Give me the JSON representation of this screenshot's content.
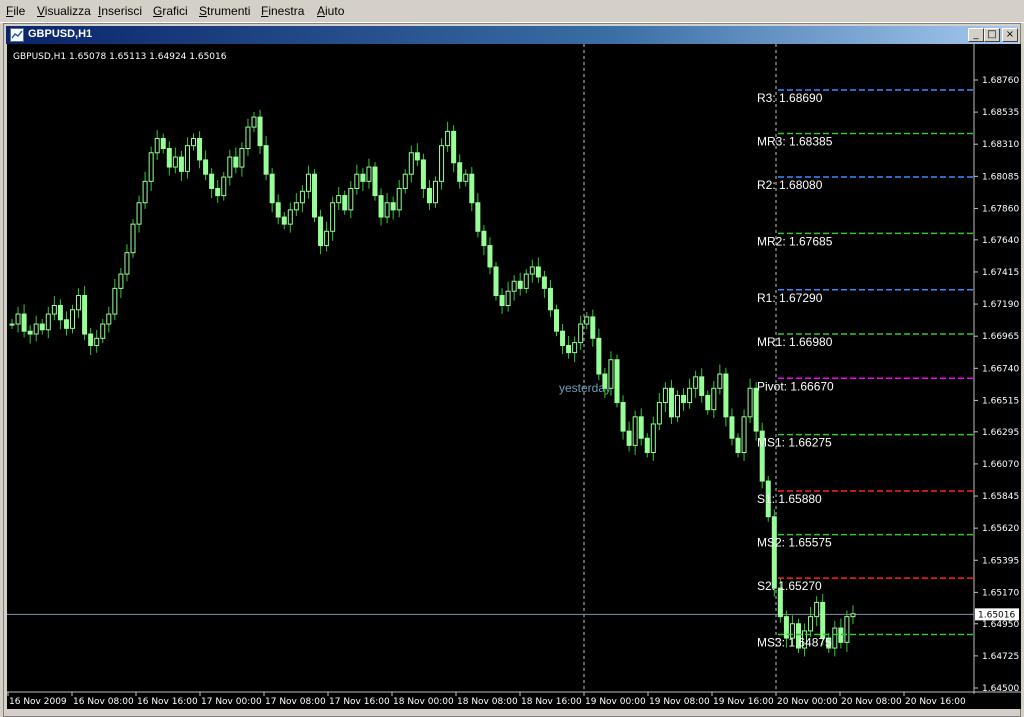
{
  "menu": [
    "File",
    "Visualizza",
    "Inserisci",
    "Grafici",
    "Strumenti",
    "Finestra",
    "Aiuto"
  ],
  "window": {
    "title": "GBPUSD,H1",
    "buttons": [
      "_",
      "□",
      "×"
    ]
  },
  "chart": {
    "info_line": "GBPUSD,H1  1.65078 1.65113 1.64924 1.65016",
    "price_ticks": [
      "1.68760",
      "1.68535",
      "1.68310",
      "1.68085",
      "1.67860",
      "1.67640",
      "1.67415",
      "1.67190",
      "1.66965",
      "1.66740",
      "1.66515",
      "1.66295",
      "1.66070",
      "1.65845",
      "1.65620",
      "1.65395",
      "1.65170",
      "1.64950",
      "1.64725",
      "1.64500"
    ],
    "price_range": [
      1.645,
      1.6885
    ],
    "current_price": "1.65016",
    "time_ticks": [
      "16 Nov 2009",
      "16 Nov 08:00",
      "16 Nov 16:00",
      "17 Nov 00:00",
      "17 Nov 08:00",
      "17 Nov 16:00",
      "18 Nov 00:00",
      "18 Nov 08:00",
      "18 Nov 16:00",
      "19 Nov 00:00",
      "19 Nov 08:00",
      "19 Nov 16:00",
      "20 Nov 00:00",
      "20 Nov 08:00",
      "20 Nov 16:00"
    ],
    "day_separators": [
      "19 Nov 00:00",
      "20 Nov 00:00"
    ],
    "yesterday_label": "yesterday",
    "levels": [
      {
        "label": "R3: 1.68690",
        "price": 1.6869,
        "color": "#3a8cff"
      },
      {
        "label": "MR3: 1.68385",
        "price": 1.68385,
        "color": "#32c832"
      },
      {
        "label": "R2: 1.68080",
        "price": 1.6808,
        "color": "#3a8cff"
      },
      {
        "label": "MR2: 1.67685",
        "price": 1.67685,
        "color": "#32c832"
      },
      {
        "label": "R1: 1.67290",
        "price": 1.6729,
        "color": "#3a8cff"
      },
      {
        "label": "MR1: 1.66980",
        "price": 1.6698,
        "color": "#32c832"
      },
      {
        "label": "Pivot: 1.66670",
        "price": 1.6667,
        "color": "#ff00ff"
      },
      {
        "label": "MS1: 1.66275",
        "price": 1.66275,
        "color": "#32c832"
      },
      {
        "label": "S1: 1.65880",
        "price": 1.6588,
        "color": "#ff2020"
      },
      {
        "label": "MS2: 1.65575",
        "price": 1.65575,
        "color": "#32c832"
      },
      {
        "label": "S2: 1.65270",
        "price": 1.6527,
        "color": "#ff2020"
      },
      {
        "label": "MS3: 1.64875",
        "price": 1.64875,
        "color": "#32c832"
      }
    ],
    "candle_color": "#98ff98",
    "wick_color": "#32c832"
  }
}
